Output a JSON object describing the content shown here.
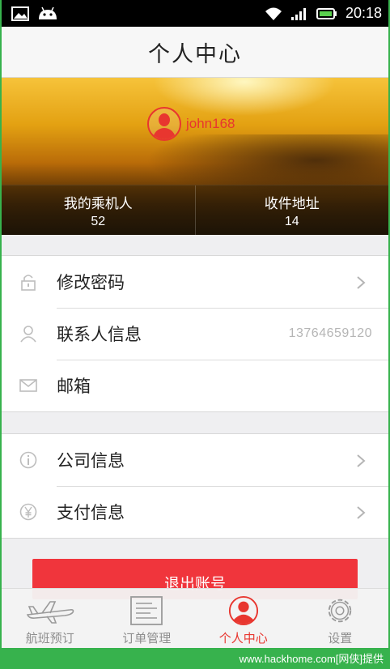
{
  "status_bar": {
    "time": "20:18",
    "icons": [
      "picture-icon",
      "android-icon",
      "wifi-icon",
      "signal-icon",
      "battery-icon"
    ]
  },
  "header": {
    "title": "个人中心"
  },
  "profile": {
    "username": "john168",
    "stats": [
      {
        "label": "我的乘机人",
        "value": "52"
      },
      {
        "label": "收件地址",
        "value": "14"
      }
    ]
  },
  "account_group": {
    "items": [
      {
        "label": "修改密码",
        "icon": "lock-icon",
        "value": "",
        "has_arrow": true
      },
      {
        "label": "联系人信息",
        "icon": "person-icon",
        "value": "13764659120",
        "has_arrow": false
      },
      {
        "label": "邮箱",
        "icon": "mail-icon",
        "value": "",
        "has_arrow": false
      }
    ]
  },
  "info_group": {
    "items": [
      {
        "label": "公司信息",
        "icon": "info-icon",
        "value": "",
        "has_arrow": true
      },
      {
        "label": "支付信息",
        "icon": "yen-icon",
        "value": "",
        "has_arrow": true
      }
    ]
  },
  "logout": {
    "label": "退出账号"
  },
  "tab_bar": {
    "tabs": [
      {
        "label": "航班预订",
        "icon": "airplane-icon",
        "active": false
      },
      {
        "label": "订单管理",
        "icon": "document-icon",
        "active": false
      },
      {
        "label": "个人中心",
        "icon": "user-icon",
        "active": true
      },
      {
        "label": "设置",
        "icon": "gear-icon",
        "active": false
      }
    ]
  },
  "watermark": "www.hackhome.com[网侠]提供",
  "colors": {
    "accent": "#e8362f",
    "logout_button": "#f0353c",
    "frame": "#37b24d"
  }
}
